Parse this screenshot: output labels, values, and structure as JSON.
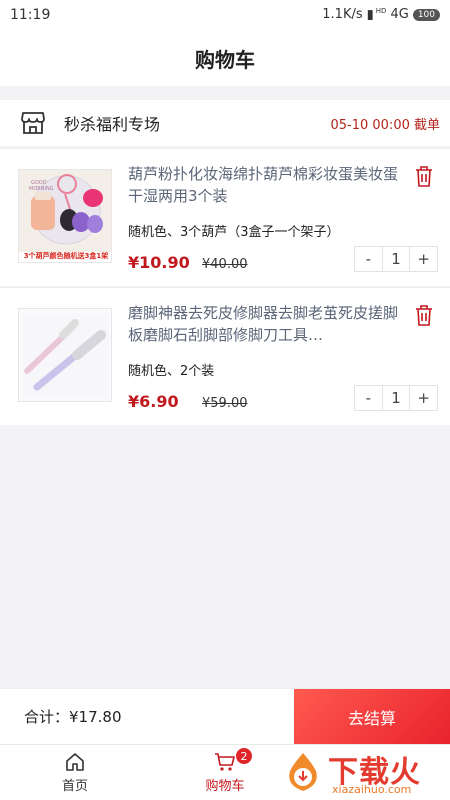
{
  "status_bar": {
    "time": "11:19",
    "network_speed": "1.1K/s",
    "hd": "HD",
    "network_type": "4G",
    "battery": "100"
  },
  "header": {
    "title": "购物车"
  },
  "shop": {
    "name": "秒杀福利专场",
    "deadline": "05-10 00:00 截单",
    "icon": "store-icon"
  },
  "items": [
    {
      "title": "葫芦粉扑化妆海绵扑葫芦棉彩妆蛋美妆蛋干湿两用3个装",
      "spec": "随机色、3个葫芦（3盒子一个架子）",
      "price": "¥10.90",
      "original_price": "¥40.00",
      "quantity": "1",
      "minus": "-",
      "plus": "+",
      "thumb_label": "3个葫芦颜色随机送3盒1架",
      "thumb_text_top": "GOOD MORNING"
    },
    {
      "title": "磨脚神器去死皮修脚器去脚老茧死皮搓脚板磨脚石刮脚部修脚刀工具…",
      "spec": "随机色、2个装",
      "price": "¥6.90",
      "original_price": "¥59.00",
      "quantity": "1",
      "minus": "-",
      "plus": "+"
    }
  ],
  "footer": {
    "total": "合计：¥17.80",
    "checkout_label": "去结算"
  },
  "tabs": [
    {
      "label": "首页",
      "icon": "home-icon"
    },
    {
      "label": "购物车",
      "icon": "cart-icon",
      "badge": "2"
    }
  ],
  "watermark": {
    "cn": "下载火",
    "en": "xiazaihuo.com"
  },
  "colors": {
    "accent": "#c0191e",
    "checkout_start": "#ff5a4f",
    "checkout_end": "#e8222d",
    "title_text": "#5b6678"
  }
}
